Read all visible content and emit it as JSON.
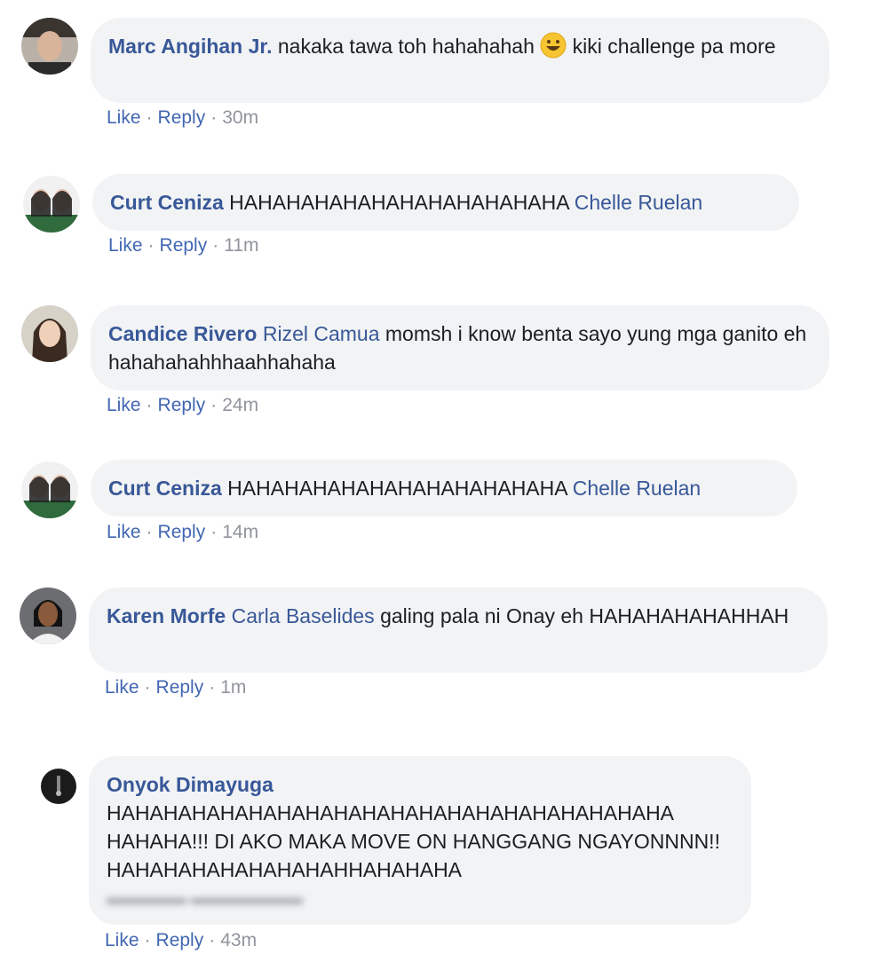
{
  "comments": [
    {
      "name": "Marc Angihan Jr.",
      "text1": " nakaka tawa toh hahahahah ",
      "emoji": "grinning-face-icon",
      "text2": " kiki challenge pa more",
      "like": "Like",
      "reply": "Reply",
      "time": "30m"
    },
    {
      "name": "Curt Ceniza",
      "text": " HAHAHAHAHAHAHAHAHAHAHAHA ",
      "tag": "Chelle Ruelan",
      "like": "Like",
      "reply": "Reply",
      "time": "11m"
    },
    {
      "name": "Candice Rivero",
      "tag": "Rizel Camua",
      "text": " momsh i know benta sayo yung mga ganito eh hahahahahhhaahhahaha",
      "like": "Like",
      "reply": "Reply",
      "time": "24m"
    },
    {
      "name": "Curt Ceniza",
      "text": " HAHAHAHAHAHAHAHAHAHAHAHA ",
      "tag": "Chelle Ruelan",
      "like": "Like",
      "reply": "Reply",
      "time": "14m"
    },
    {
      "name": "Karen Morfe",
      "tag": "Carla Baselides",
      "text": " galing pala ni Onay eh HAHAHAHAHAHHAH",
      "like": "Like",
      "reply": "Reply",
      "time": "1m"
    },
    {
      "name": "Onyok Dimayuga",
      "text": "HAHAHAHAHAHAHAHAHAHAHAHAHAHAHAHAHAHAHAHA HAHAHA!!! DI AKO MAKA MOVE ON HANGGANG NGAYONNNN!! HAHAHAHAHAHAHAHAHHAHAHAHA",
      "like": "Like",
      "reply": "Reply",
      "time": "43m"
    }
  ],
  "colors": {
    "link": "#385898",
    "bubble": "#f2f3f5",
    "meta": "#90949c"
  }
}
